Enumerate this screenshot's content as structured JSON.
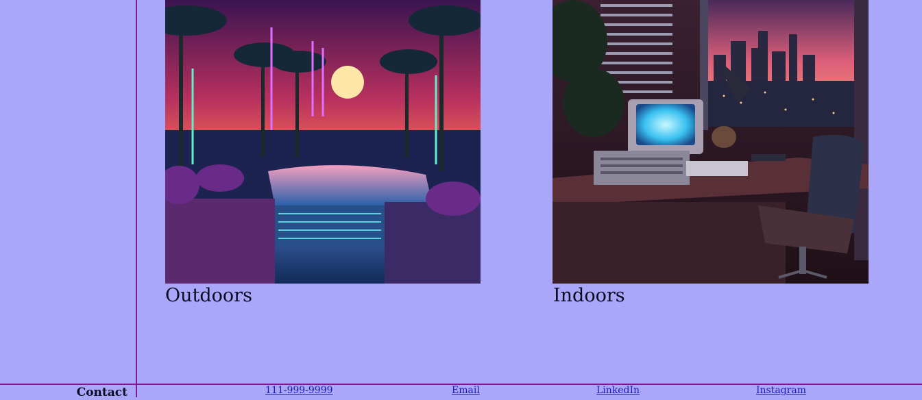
{
  "gallery": {
    "items": [
      {
        "caption": "Outdoors"
      },
      {
        "caption": "Indoors"
      }
    ]
  },
  "footer": {
    "label": "Contact",
    "links": [
      {
        "label": "111-999-9999"
      },
      {
        "label": "Email"
      },
      {
        "label": "LinkedIn"
      },
      {
        "label": "Instagram"
      }
    ]
  },
  "colors": {
    "background": "#aaa6f9",
    "divider": "#7a1b8f",
    "link": "#1c1cb8"
  }
}
